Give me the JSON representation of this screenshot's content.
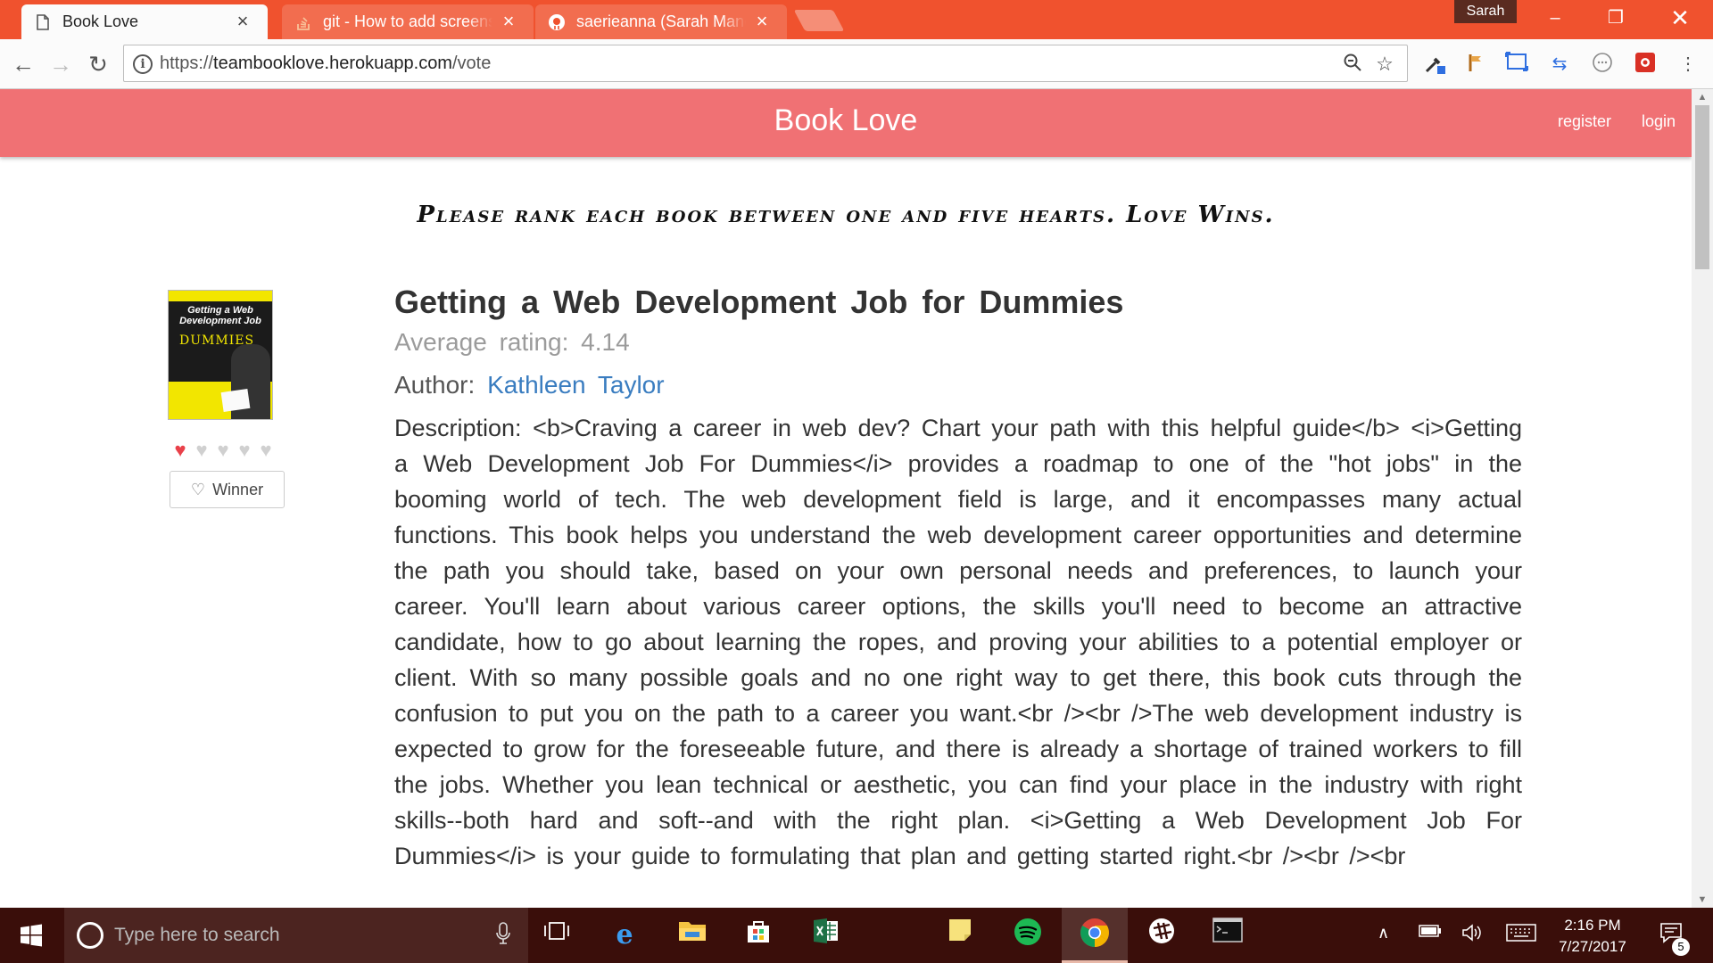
{
  "browser": {
    "tabs": [
      {
        "title": "Book Love",
        "icon": "page-icon",
        "active": true
      },
      {
        "title": "git - How to add screens",
        "icon": "stackoverflow-icon",
        "active": false
      },
      {
        "title": "saerieanna (Sarah Mandl",
        "icon": "github-icon",
        "active": false
      }
    ],
    "profile_name": "Sarah",
    "url_scheme": "https://",
    "url_host": "teambooklove.herokuapp.com",
    "url_path": "/vote",
    "accent_color": "#f0522e"
  },
  "site": {
    "brand": "Book Love",
    "nav": {
      "register": "register",
      "login": "login"
    },
    "navbar_color": "#f07174",
    "tagline": "Please rank each book between one and five hearts. Love Wins."
  },
  "book": {
    "cover": {
      "title_line": "Getting a Web Development Job",
      "series": "DUMMIES"
    },
    "rating_hearts": {
      "filled": 1,
      "total": 5
    },
    "winner_label": "Winner",
    "title": "Getting a Web Development Job for Dummies",
    "average_rating_label": "Average rating:",
    "average_rating": "4.14",
    "author_label": "Author:",
    "author": "Kathleen Taylor",
    "description_label": "Description:",
    "description": "<b>Craving a career in web dev? Chart your path with this helpful guide</b> <i>Getting a Web Development Job For Dummies</i> provides a roadmap to one of the \"hot jobs\" in the booming world of tech. The web development field is large, and it encompasses many actual functions. This book helps you understand the web development career opportunities and determine the path you should take, based on your own personal needs and preferences, to launch your career. You'll learn about various career options, the skills you'll need to become an attractive candidate, how to go about learning the ropes, and proving your abilities to a potential employer or client. With so many possible goals and no one right way to get there, this book cuts through the confusion to put you on the path to a career you want.<br /><br />The web development industry is expected to grow for the foreseeable future, and there is already a shortage of trained workers to fill the jobs. Whether you lean technical or aesthetic, you can find your place in the industry with right skills--both hard and soft--and with the right plan. <i>Getting a Web Development Job For Dummies</i> is your guide to formulating that plan and getting started right.<br /><br /><br"
  },
  "taskbar": {
    "search_placeholder": "Type here to search",
    "time": "2:16 PM",
    "date": "7/27/2017",
    "notification_count": "5"
  }
}
